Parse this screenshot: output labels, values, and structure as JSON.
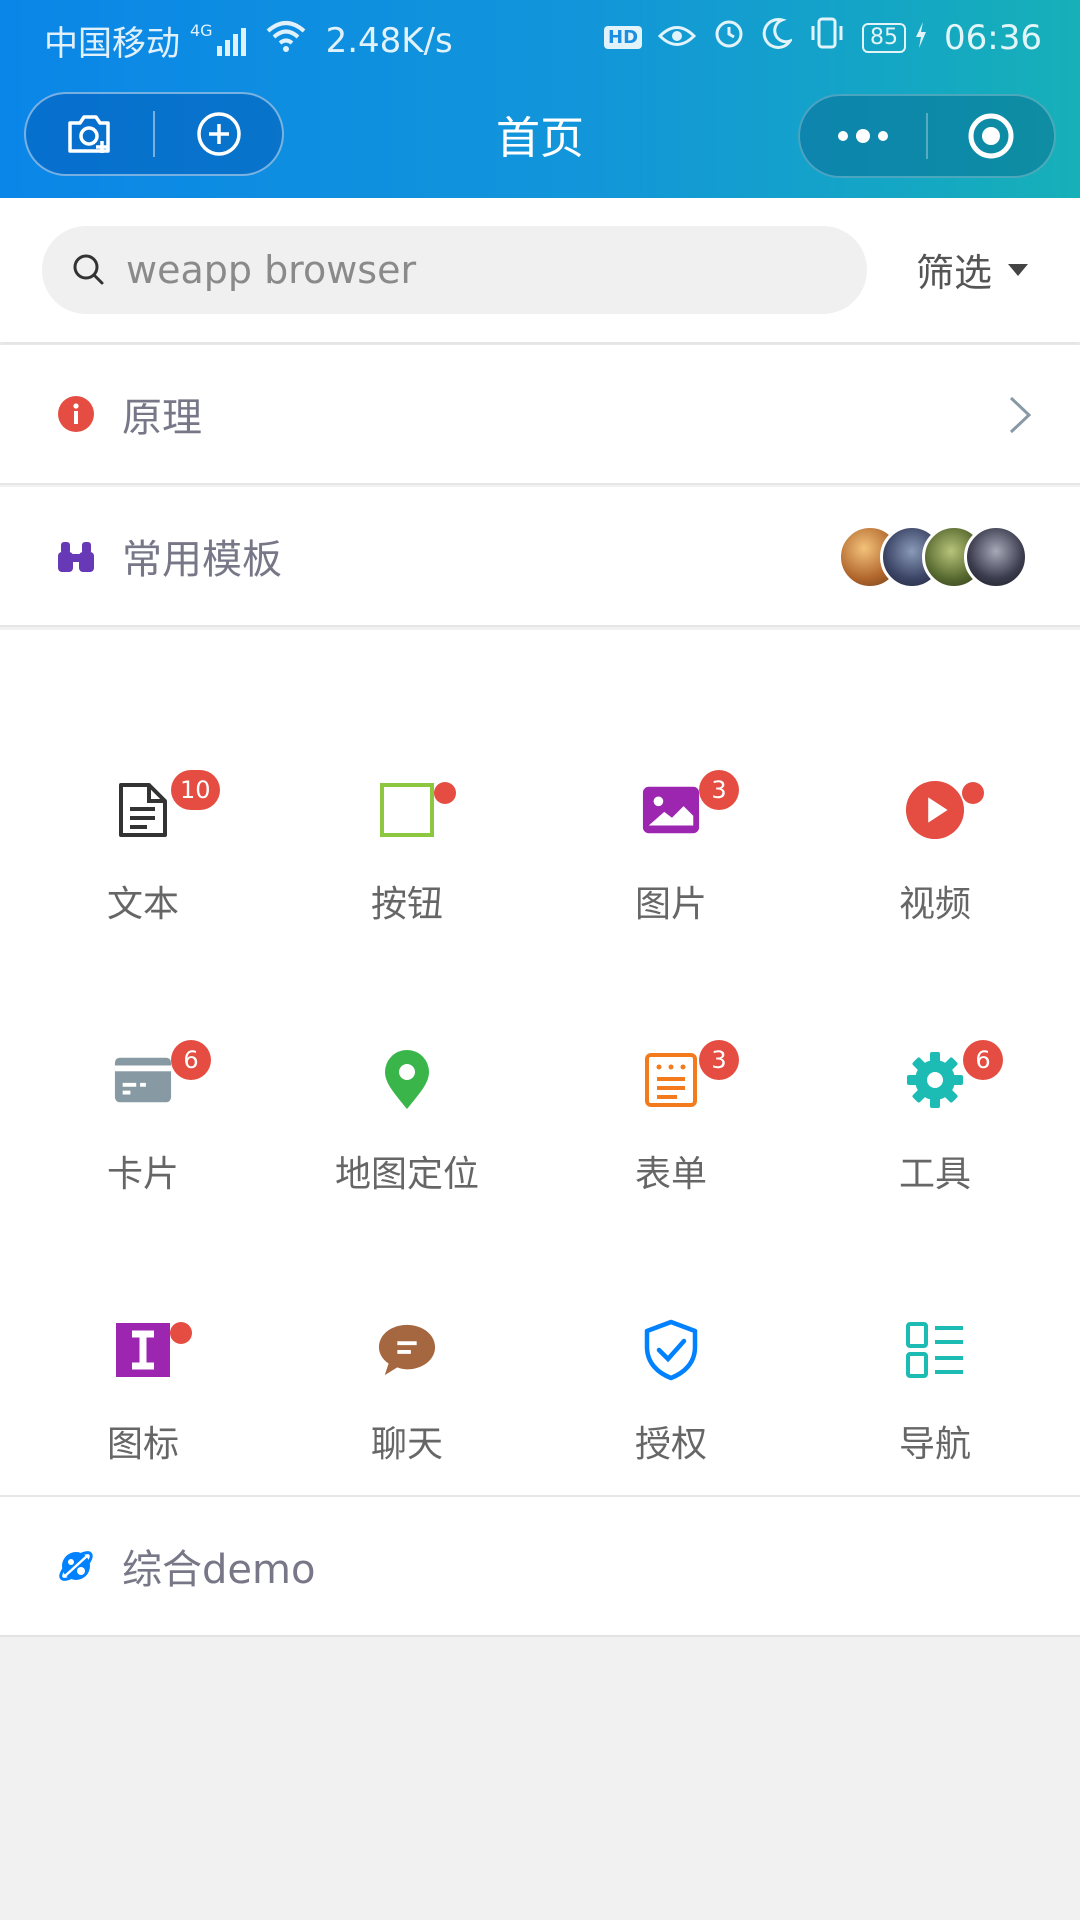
{
  "status_bar": {
    "carrier": "中国移动",
    "network_tag": "4G",
    "speed": "2.48K/s",
    "hd": "HD",
    "battery": "85",
    "time": "06:36"
  },
  "nav": {
    "title": "首页"
  },
  "search": {
    "placeholder": "weapp browser",
    "filter_label": "筛选"
  },
  "rows": {
    "principle": "原理",
    "templates": "常用模板",
    "demo": "综合demo"
  },
  "grid": [
    {
      "label": "文本",
      "badge": "10",
      "icon": "document-icon",
      "color": "#333333"
    },
    {
      "label": "按钮",
      "badge": "",
      "dot": true,
      "icon": "square-button-icon",
      "color": "#8dc63f"
    },
    {
      "label": "图片",
      "badge": "3",
      "icon": "image-icon",
      "color": "#9c26b0"
    },
    {
      "label": "视频",
      "badge": "",
      "dot": true,
      "icon": "play-icon",
      "color": "#e54d42"
    },
    {
      "label": "卡片",
      "badge": "6",
      "icon": "card-icon",
      "color": "#8799a3"
    },
    {
      "label": "地图定位",
      "badge": "",
      "icon": "location-pin-icon",
      "color": "#39b54a"
    },
    {
      "label": "表单",
      "badge": "3",
      "icon": "form-icon",
      "color": "#f37b1d"
    },
    {
      "label": "工具",
      "badge": "6",
      "icon": "gear-icon",
      "color": "#1cbbb4"
    },
    {
      "label": "图标",
      "badge": "",
      "dot": true,
      "icon": "icon-letter-icon",
      "color": "#9c26b0"
    },
    {
      "label": "聊天",
      "badge": "",
      "icon": "chat-bubble-icon",
      "color": "#a5673f"
    },
    {
      "label": "授权",
      "badge": "",
      "icon": "shield-check-icon",
      "color": "#0081ff"
    },
    {
      "label": "导航",
      "badge": "",
      "icon": "list-nav-icon",
      "color": "#1cbbb4"
    }
  ],
  "colors": {
    "header_start": "#0a86e8",
    "header_end": "#16b0b8",
    "badge": "#e54d42",
    "page_bg": "#f1f1f1"
  }
}
